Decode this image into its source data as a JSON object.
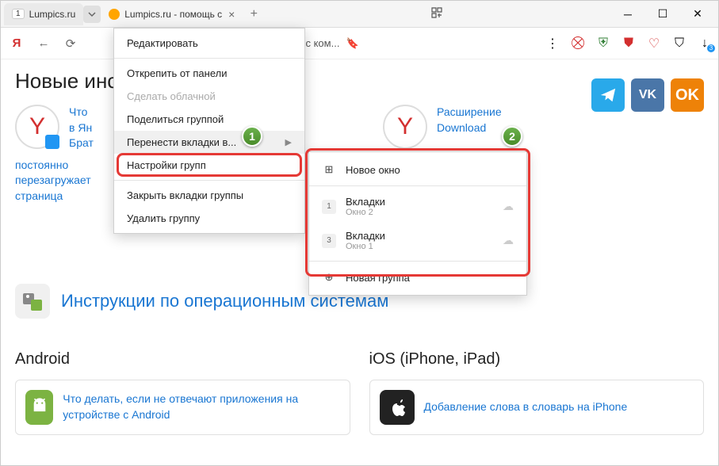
{
  "tabs": {
    "t1_count": "1",
    "t1_label": "Lumpics.ru",
    "t2_label": "Lumpics.ru - помощь с"
  },
  "addr": {
    "text": "омощь с ком..."
  },
  "page": {
    "h1": "Новые инст",
    "card1_line": "Что",
    "card1_l2": "в Ян",
    "card1_l3": "Брат",
    "card1_extra1": "постоянно",
    "card1_extra2": "перезагружает",
    "card1_extra3": "страница",
    "card2_l1": "Расширение",
    "card2_l2": "Download",
    "section_title": "Инструкции по операционным системам",
    "android_h": "Android",
    "android_link": "Что делать, если не отвечают приложения на устройстве с Android",
    "ios_h": "iOS (iPhone, iPad)",
    "ios_link": "Добавление слова в словарь на iPhone"
  },
  "ctx": {
    "edit": "Редактировать",
    "unpin": "Открепить от панели",
    "cloud": "Сделать облачной",
    "share": "Поделиться группой",
    "move": "Перенести вкладки в...",
    "settings": "Настройки групп",
    "close": "Закрыть вкладки группы",
    "delete": "Удалить группу"
  },
  "sub": {
    "newwin": "Новое окно",
    "tabs_lbl": "Вкладки",
    "win2": "Окно 2",
    "win1": "Окно 1",
    "g1_count": "1",
    "g3_count": "3",
    "newgroup": "Новая группа"
  },
  "badges": {
    "b1": "1",
    "b2": "2"
  },
  "social": {
    "vk": "VK",
    "ok": "OK"
  }
}
